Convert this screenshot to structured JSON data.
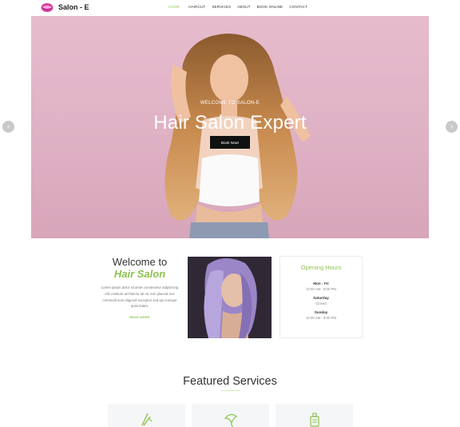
{
  "header": {
    "brand": "Salon - E",
    "nav": [
      {
        "label": "HOME",
        "active": true
      },
      {
        "label": "HAIRCUT",
        "active": false
      },
      {
        "label": "SERVICES",
        "active": false
      },
      {
        "label": "ABOUT",
        "active": false
      },
      {
        "label": "BOOK ONLINE",
        "active": false
      },
      {
        "label": "CONTACT",
        "active": false
      }
    ]
  },
  "hero": {
    "subtitle": "WELCOME TO SALON-E",
    "title": "Hair Salon Expert",
    "button": "Book Now!"
  },
  "welcome": {
    "line1": "Welcome to",
    "line2": "Hair Salon",
    "text": "Lorem ipsum dolor sit amet consectetur adipisicing elit. molitum architecto ab nic rem placeat eos commodi eum eligendi excepturi sed qui cumque quisi.totam.",
    "read_more": "READ MORE"
  },
  "hours": {
    "title": "Opening Hours",
    "rows": [
      {
        "day": "Mon - Fri",
        "time": "10:00 AM - 8:00 PM"
      },
      {
        "day": "Saturday",
        "time": "Closed"
      },
      {
        "day": "Sunday",
        "time": "10:00 AM - 8:00 PM"
      }
    ]
  },
  "featured": {
    "title": "Featured Services"
  },
  "colors": {
    "accent": "#8ec14f",
    "nav_active": "#9bc65a",
    "button": "#111111"
  },
  "icons": {
    "logo": "lips-icon",
    "left_arrow": "chevron-left-icon",
    "right_arrow": "chevron-right-icon",
    "service1": "straightener-icon",
    "service2": "face-icon",
    "service3": "bottle-icon"
  }
}
